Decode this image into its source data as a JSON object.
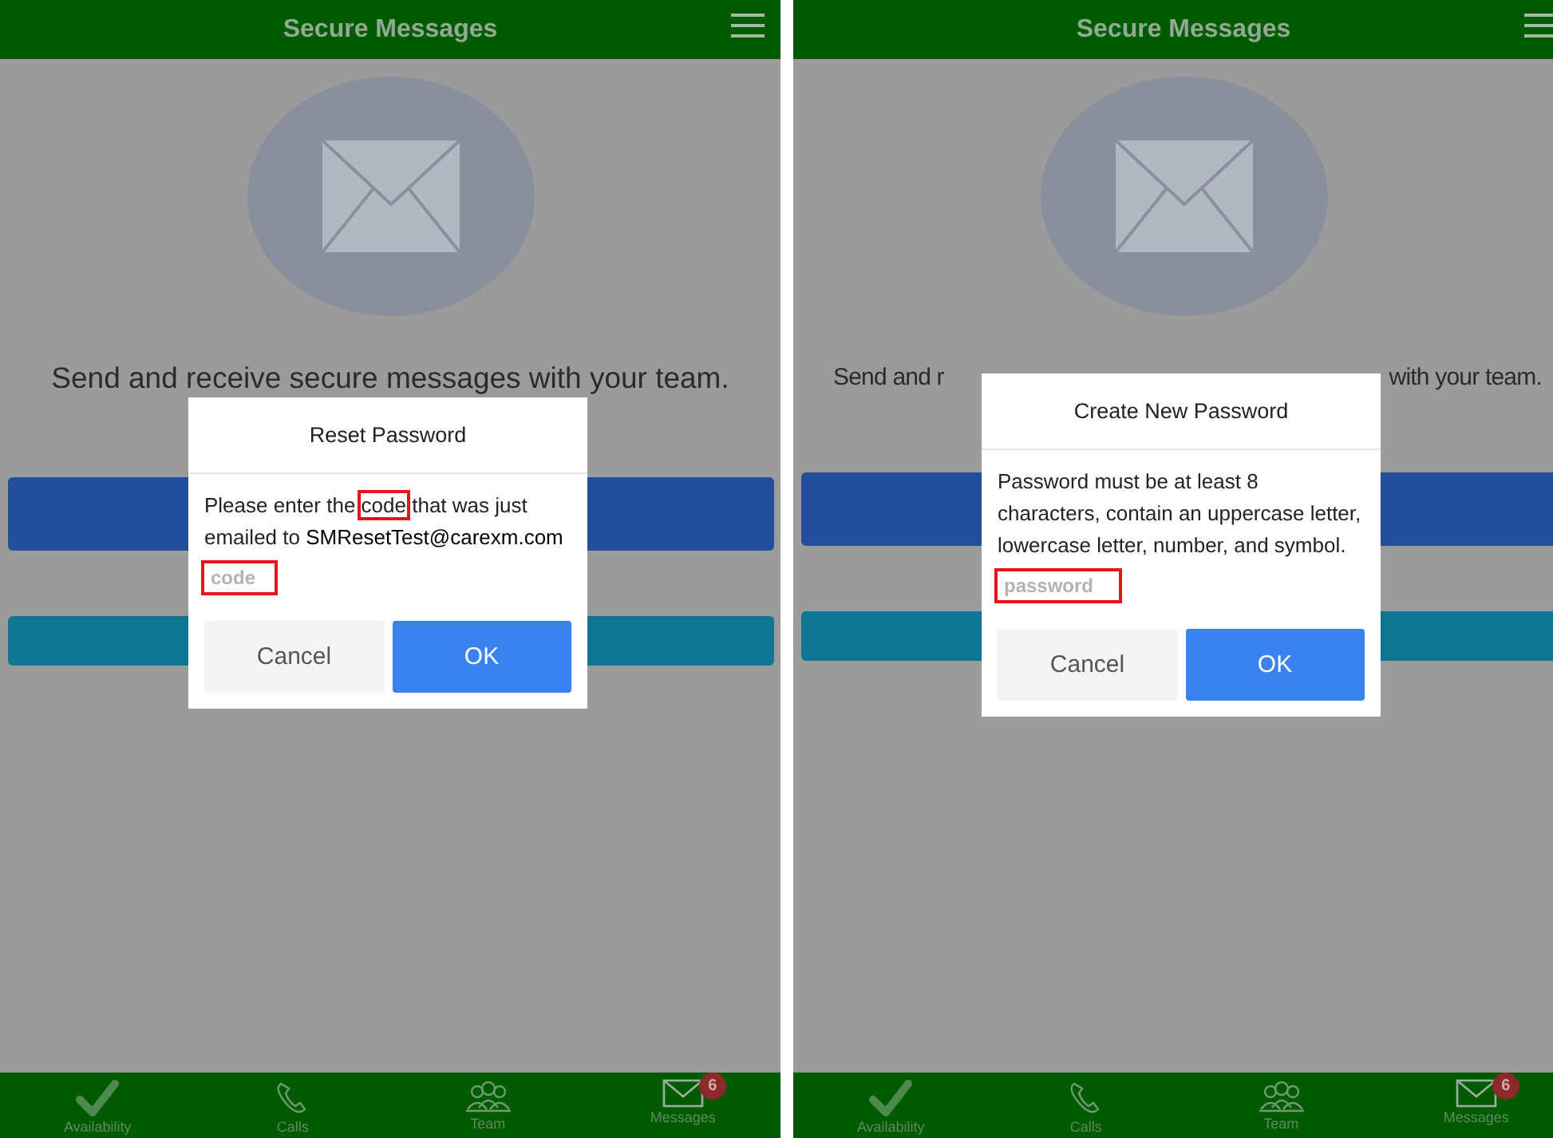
{
  "screens": [
    {
      "header": {
        "title": "Secure Messages"
      },
      "intro": {
        "parts": [
          "Send and receive secure messages with your team."
        ]
      },
      "dialog": {
        "title": "Reset Password",
        "message": [
          {
            "text": "Please enter the ",
            "highlighted": false
          },
          {
            "text": "code",
            "highlighted": true
          },
          {
            "text": " that was just emailed to ",
            "highlighted": false
          },
          {
            "text": "SMResetTest@carexm.com",
            "highlighted": false
          }
        ],
        "field": {
          "placeholder": "code",
          "highlighted": true
        },
        "buttons": [
          {
            "label": "Cancel",
            "kind": "secondary"
          },
          {
            "label": "OK",
            "kind": "primary"
          }
        ]
      },
      "tabs": [
        {
          "label": "Availability"
        },
        {
          "label": "Calls"
        },
        {
          "label": "Team"
        },
        {
          "label": "Messages",
          "badge": "6"
        }
      ]
    },
    {
      "header": {
        "title": "Secure Messages"
      },
      "intro": {
        "parts": [
          "Send and r",
          "with your team."
        ]
      },
      "dialog": {
        "title": "Create New Password",
        "message": [
          {
            "text": "Password must be at least 8 characters, contain an uppercase letter, lowercase letter, number, and symbol.",
            "highlighted": false
          }
        ],
        "field": {
          "placeholder": "password",
          "highlighted": true
        },
        "buttons": [
          {
            "label": "Cancel",
            "kind": "secondary"
          },
          {
            "label": "OK",
            "kind": "primary"
          }
        ]
      },
      "tabs": [
        {
          "label": "Availability"
        },
        {
          "label": "Calls"
        },
        {
          "label": "Team"
        },
        {
          "label": "Messages",
          "badge": "6"
        }
      ]
    }
  ]
}
